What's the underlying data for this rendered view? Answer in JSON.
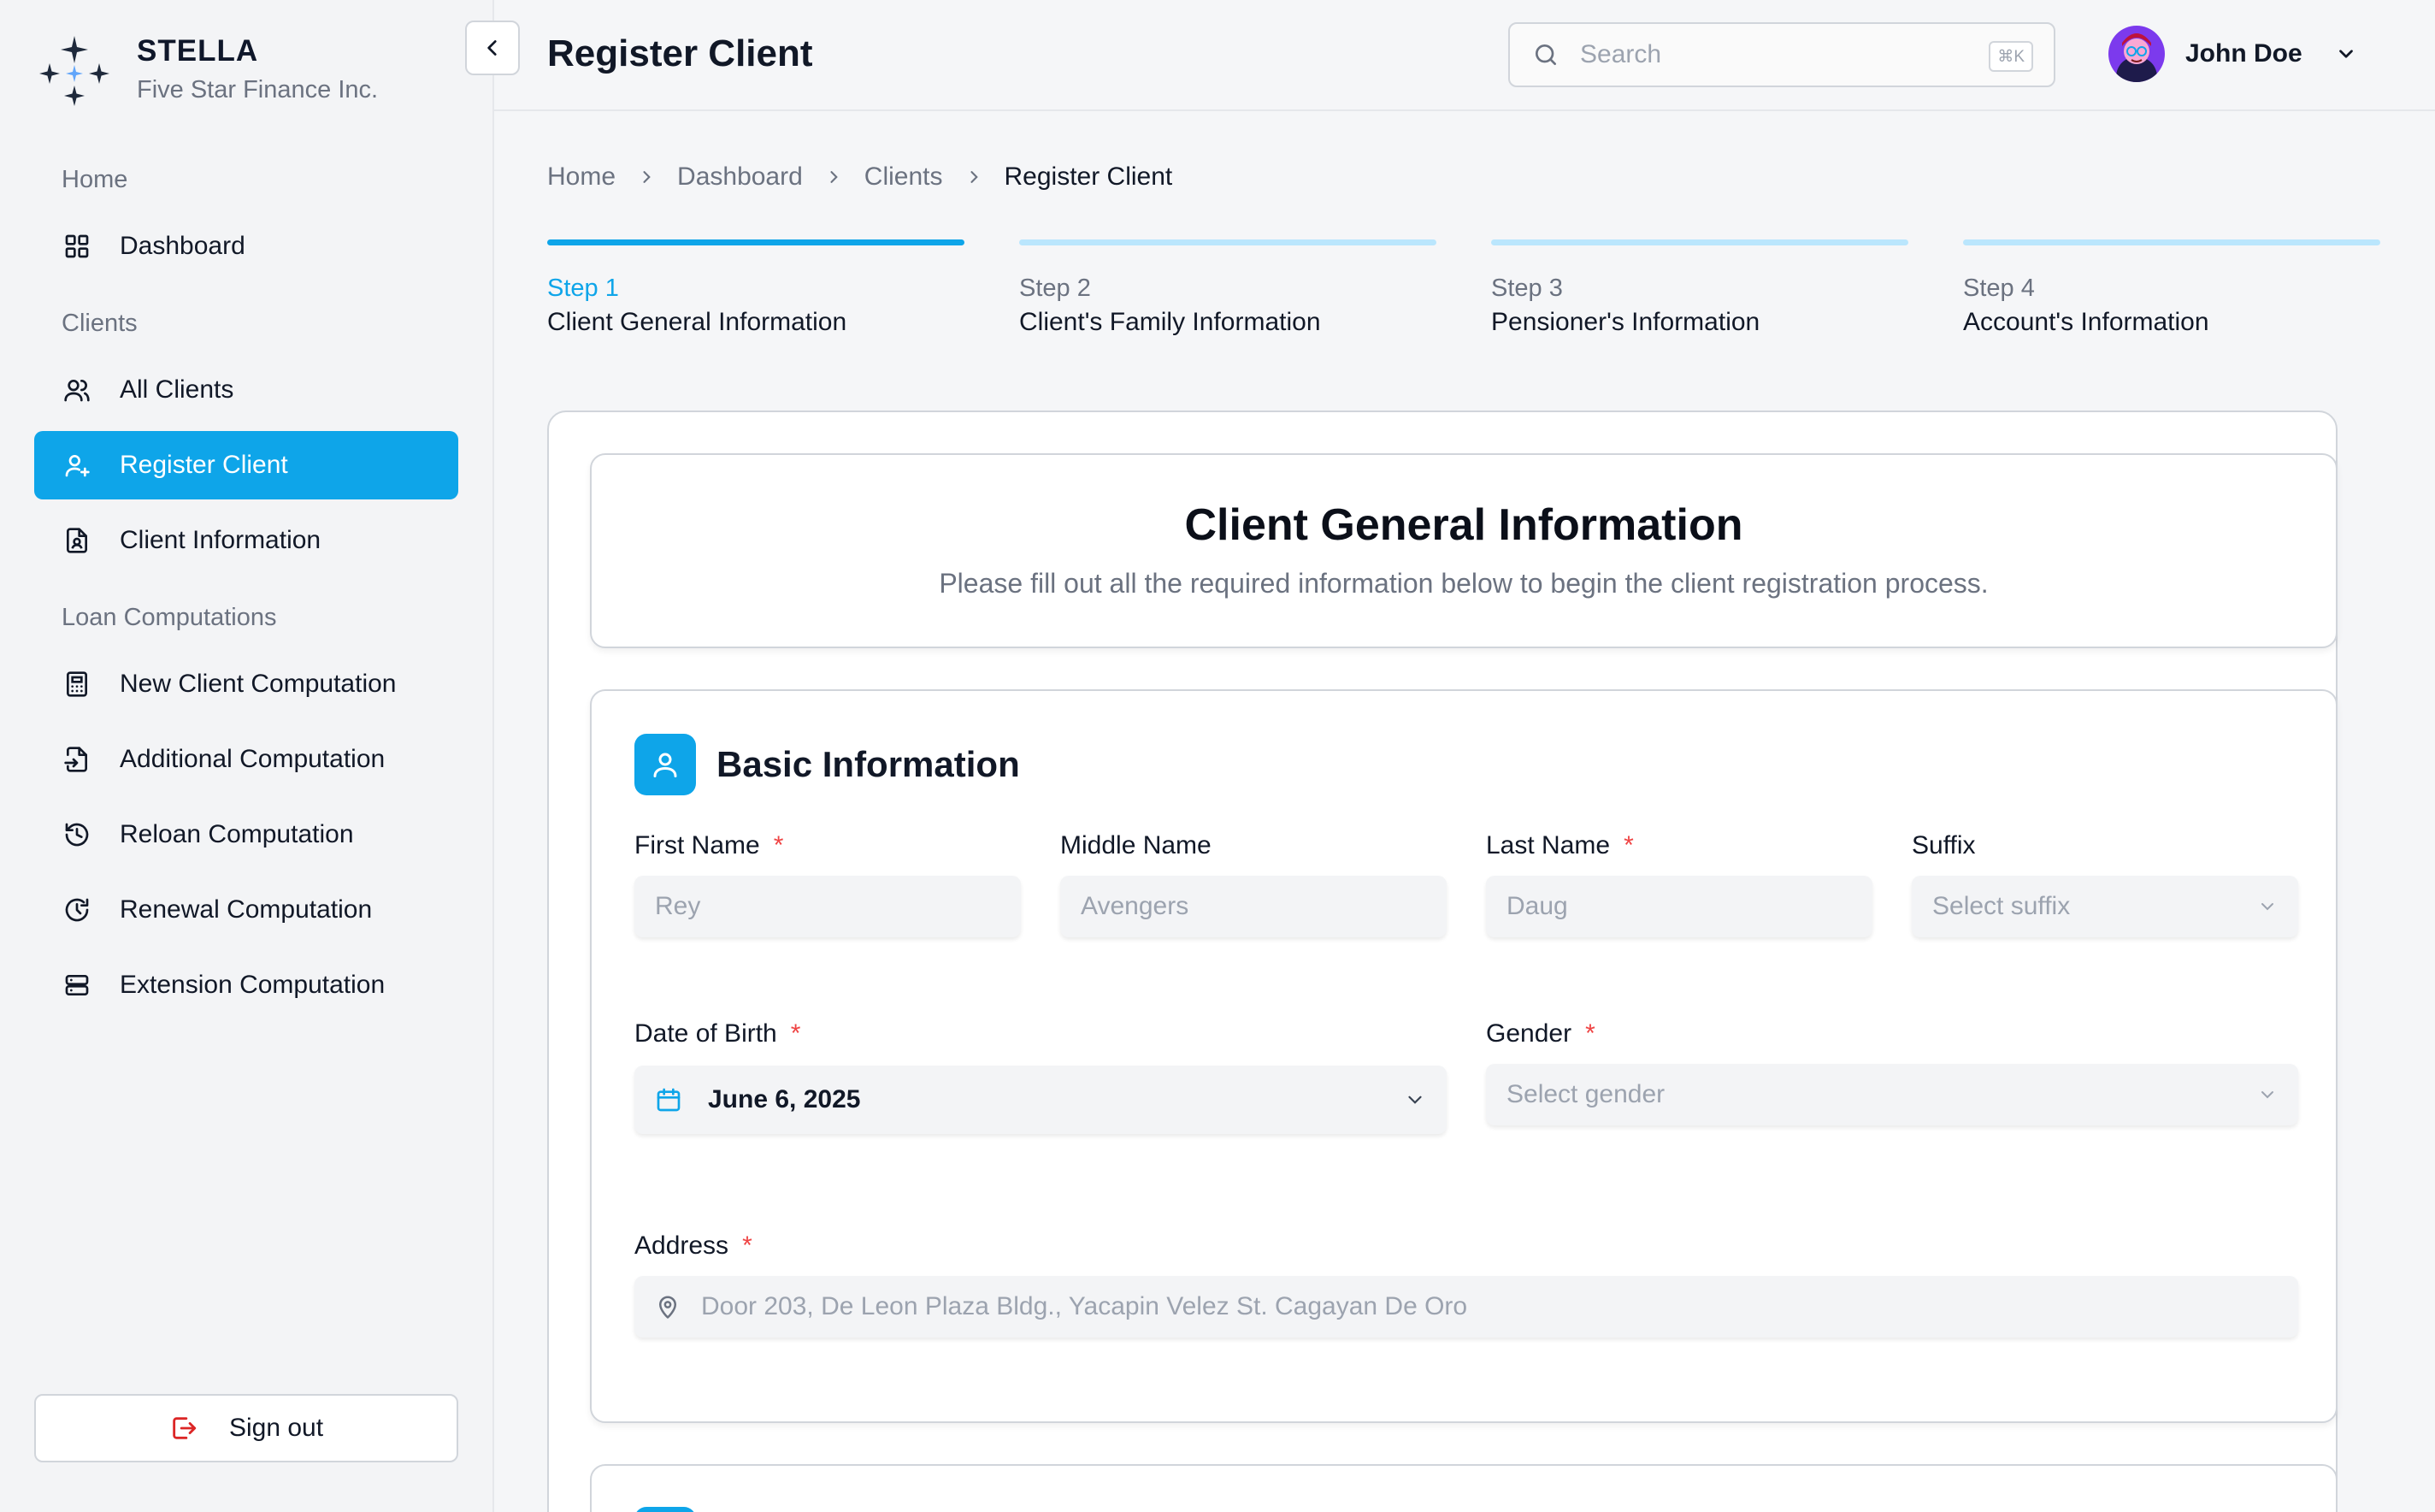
{
  "brand": {
    "name": "STELLA",
    "subtitle": "Five Star Finance Inc."
  },
  "sidebar": {
    "sections": [
      {
        "label": "Home"
      },
      {
        "label": "Clients"
      },
      {
        "label": "Loan Computations"
      }
    ],
    "items": [
      {
        "label": "Dashboard",
        "icon": "grid-icon"
      },
      {
        "label": "All Clients",
        "icon": "users-icon"
      },
      {
        "label": "Register Client",
        "icon": "user-plus-icon",
        "active": true
      },
      {
        "label": "Client Information",
        "icon": "file-user-icon"
      },
      {
        "label": "New Client Computation",
        "icon": "calculator-icon"
      },
      {
        "label": "Additional Computation",
        "icon": "file-plus-icon"
      },
      {
        "label": "Reloan Computation",
        "icon": "history-icon"
      },
      {
        "label": "Renewal Computation",
        "icon": "clock-refresh-icon"
      },
      {
        "label": "Extension Computation",
        "icon": "server-icon"
      }
    ],
    "sign_out": "Sign out"
  },
  "header": {
    "title": "Register Client",
    "search_placeholder": "Search",
    "search_shortcut": "⌘K",
    "user_name": "John Doe"
  },
  "breadcrumb": [
    "Home",
    "Dashboard",
    "Clients",
    "Register Client"
  ],
  "steps": [
    {
      "num": "Step 1",
      "title": "Client General Information",
      "active": true
    },
    {
      "num": "Step 2",
      "title": "Client's Family Information",
      "active": false
    },
    {
      "num": "Step 3",
      "title": "Pensioner's Information",
      "active": false
    },
    {
      "num": "Step 4",
      "title": "Account's Information",
      "active": false
    }
  ],
  "intro": {
    "title": "Client General Information",
    "subtitle": "Please fill out all the required information below to begin the client registration process."
  },
  "basic": {
    "title": "Basic Information",
    "first_name": {
      "label": "First Name",
      "placeholder": "Rey",
      "required": "*"
    },
    "middle_name": {
      "label": "Middle Name",
      "placeholder": "Avengers"
    },
    "last_name": {
      "label": "Last Name",
      "placeholder": "Daug",
      "required": "*"
    },
    "suffix": {
      "label": "Suffix",
      "placeholder": "Select suffix"
    },
    "dob": {
      "label": "Date of Birth",
      "value": "June 6, 2025",
      "required": "*"
    },
    "gender": {
      "label": "Gender",
      "placeholder": "Select gender",
      "required": "*"
    },
    "address": {
      "label": "Address",
      "placeholder": "Door 203, De Leon Plaza Bldg., Yacapin Velez St. Cagayan De Oro",
      "required": "*"
    }
  },
  "colors": {
    "accent": "#0ea5e9",
    "accent_light": "#bae6fd",
    "required": "#ef4444",
    "sign_out_icon": "#dc2626"
  }
}
